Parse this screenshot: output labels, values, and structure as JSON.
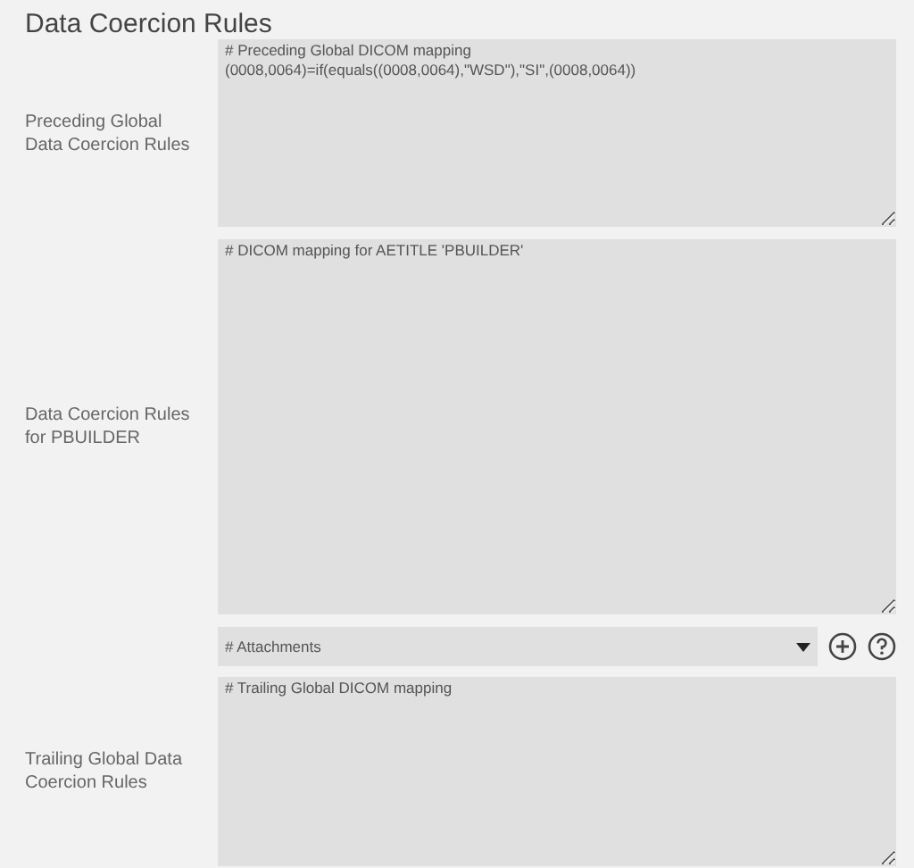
{
  "title": "Data Coercion Rules",
  "rows": [
    {
      "kind": "textarea",
      "label": "Preceding Global Data Coercion Rules",
      "lines": [
        "# Preceding Global DICOM mapping",
        "(0008,0064)=if(equals((0008,0064),\"WSD\"),\"SI\",(0008,0064))"
      ]
    },
    {
      "kind": "textarea",
      "label": "Data Coercion Rules for PBUILDER",
      "lines": [
        "# DICOM mapping for AETITLE 'PBUILDER'"
      ]
    },
    {
      "kind": "select",
      "value": "# Attachments"
    },
    {
      "kind": "textarea",
      "label": "Trailing Global Data Coercion Rules",
      "lines": [
        "# Trailing Global DICOM mapping"
      ]
    }
  ]
}
